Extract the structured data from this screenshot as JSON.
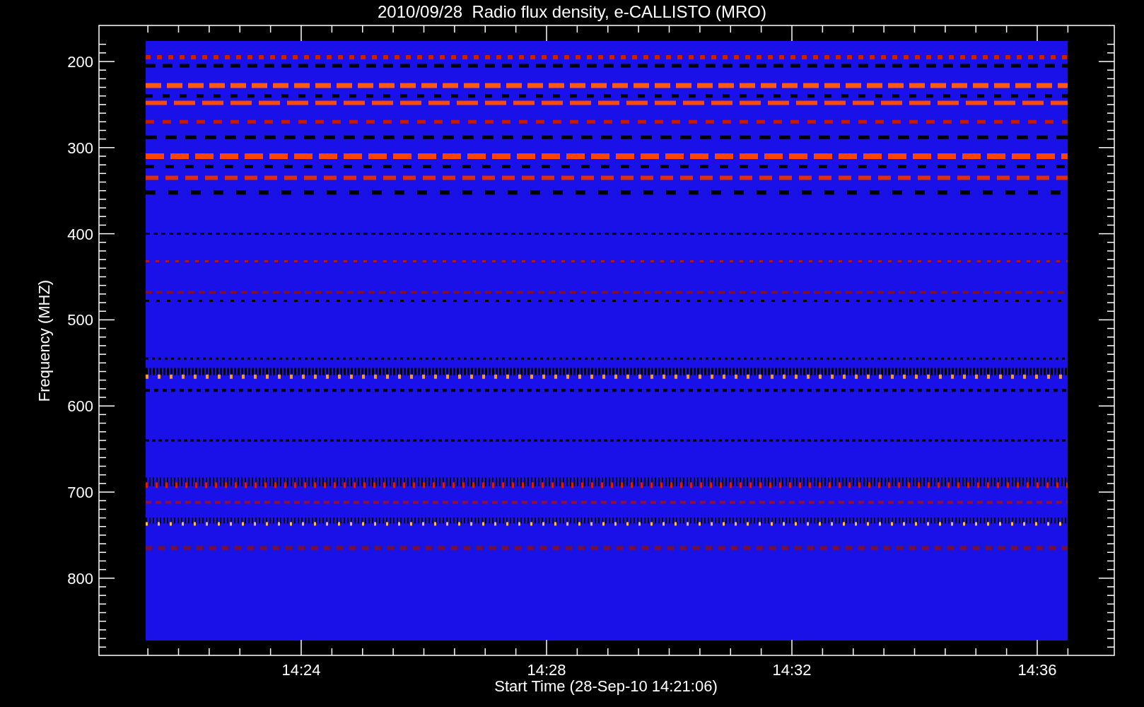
{
  "title": "2010/09/28  Radio flux density, e-CALLISTO (MRO)",
  "plot": {
    "y_axis": {
      "label": "Frequency (MHZ)",
      "ticks": [
        "200",
        "300",
        "400",
        "500",
        "600",
        "700",
        "800"
      ]
    },
    "x_axis": {
      "label": "Start Time (28-Sep-10 14:21:06)",
      "ticks": [
        "14:24",
        "14:28",
        "14:32",
        "14:36"
      ]
    }
  }
}
